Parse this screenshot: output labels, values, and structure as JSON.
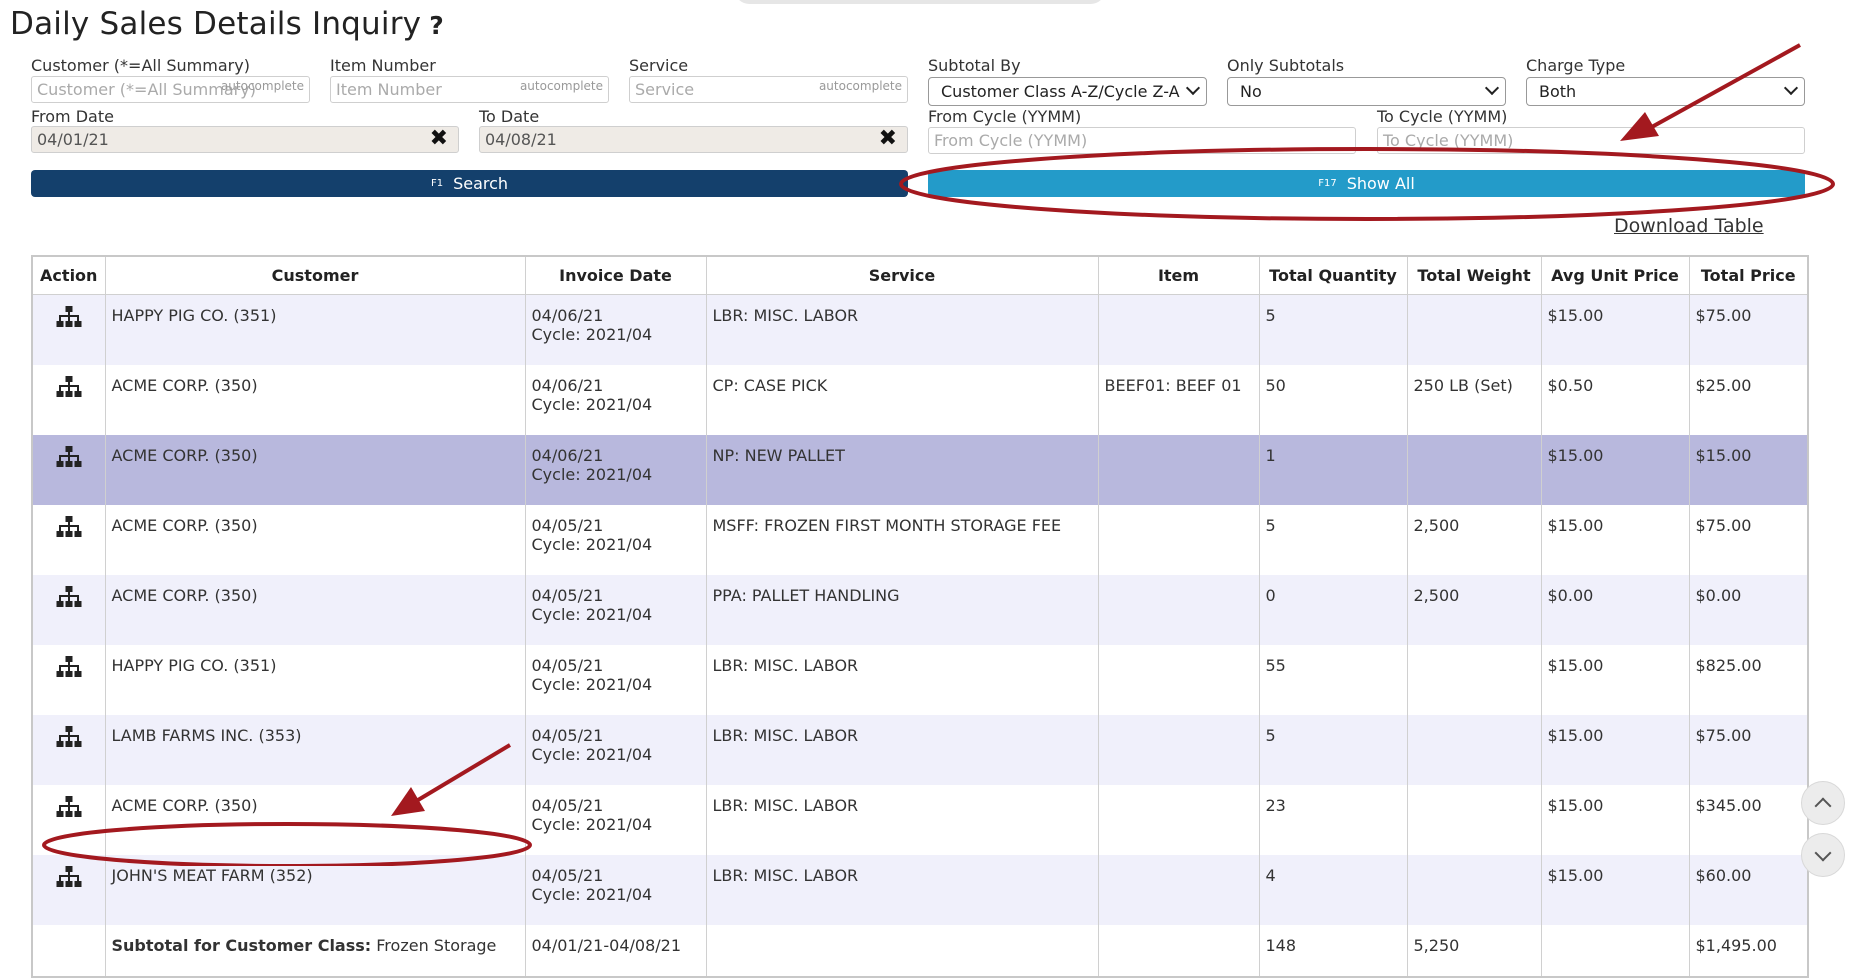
{
  "page": {
    "title": "Daily Sales Details Inquiry",
    "help_glyph": "?"
  },
  "filters": {
    "customer": {
      "label": "Customer (*=All Summary)",
      "placeholder": "Customer (*=All Summary)",
      "hint": "autocomplete"
    },
    "item_number": {
      "label": "Item Number",
      "placeholder": "Item Number",
      "hint": "autocomplete"
    },
    "service": {
      "label": "Service",
      "placeholder": "Service",
      "hint": "autocomplete"
    },
    "subtotal_by": {
      "label": "Subtotal By",
      "value": "Customer Class A-Z/Cycle Z-A"
    },
    "only_subtotals": {
      "label": "Only Subtotals",
      "value": "No"
    },
    "charge_type": {
      "label": "Charge Type",
      "value": "Both"
    },
    "from_date": {
      "label": "From Date",
      "value": "04/01/21",
      "clear_glyph": "✖"
    },
    "to_date": {
      "label": "To Date",
      "value": "04/08/21",
      "clear_glyph": "✖"
    },
    "from_cycle": {
      "label": "From Cycle (YYMM)",
      "placeholder": "From Cycle (YYMM)"
    },
    "to_cycle": {
      "label": "To Cycle (YYMM)",
      "placeholder": "To Cycle (YYMM)"
    }
  },
  "buttons": {
    "search": {
      "key": "F1",
      "label": "Search"
    },
    "show_all": {
      "key": "F17",
      "label": "Show All"
    }
  },
  "download_label": "Download Table",
  "table": {
    "headers": [
      "Action",
      "Customer",
      "Invoice Date",
      "Service",
      "Item",
      "Total Quantity",
      "Total Weight",
      "Avg Unit Price",
      "Total Price"
    ],
    "action_icon": "sitemap-icon",
    "rows": [
      {
        "customer": "HAPPY PIG CO. (351)",
        "date": "04/06/21",
        "cycle": "Cycle: 2021/04",
        "service": "LBR: MISC. LABOR",
        "item": "",
        "qty": "5",
        "weight": "",
        "unit_price": "$15.00",
        "total": "$75.00"
      },
      {
        "customer": "ACME CORP. (350)",
        "date": "04/06/21",
        "cycle": "Cycle: 2021/04",
        "service": "CP: CASE PICK",
        "item": "BEEF01: BEEF 01",
        "qty": "50",
        "weight": "250 LB (Set)",
        "unit_price": "$0.50",
        "total": "$25.00"
      },
      {
        "customer": "ACME CORP. (350)",
        "date": "04/06/21",
        "cycle": "Cycle: 2021/04",
        "service": "NP: NEW PALLET",
        "item": "",
        "qty": "1",
        "weight": "",
        "unit_price": "$15.00",
        "total": "$15.00"
      },
      {
        "customer": "ACME CORP. (350)",
        "date": "04/05/21",
        "cycle": "Cycle: 2021/04",
        "service": "MSFF: FROZEN FIRST MONTH STORAGE FEE",
        "item": "",
        "qty": "5",
        "weight": "2,500",
        "unit_price": "$15.00",
        "total": "$75.00"
      },
      {
        "customer": "ACME CORP. (350)",
        "date": "04/05/21",
        "cycle": "Cycle: 2021/04",
        "service": "PPA: PALLET HANDLING",
        "item": "",
        "qty": "0",
        "weight": "2,500",
        "unit_price": "$0.00",
        "total": "$0.00"
      },
      {
        "customer": "HAPPY PIG CO. (351)",
        "date": "04/05/21",
        "cycle": "Cycle: 2021/04",
        "service": "LBR: MISC. LABOR",
        "item": "",
        "qty": "55",
        "weight": "",
        "unit_price": "$15.00",
        "total": "$825.00"
      },
      {
        "customer": "LAMB FARMS INC. (353)",
        "date": "04/05/21",
        "cycle": "Cycle: 2021/04",
        "service": "LBR: MISC. LABOR",
        "item": "",
        "qty": "5",
        "weight": "",
        "unit_price": "$15.00",
        "total": "$75.00"
      },
      {
        "customer": "ACME CORP. (350)",
        "date": "04/05/21",
        "cycle": "Cycle: 2021/04",
        "service": "LBR: MISC. LABOR",
        "item": "",
        "qty": "23",
        "weight": "",
        "unit_price": "$15.00",
        "total": "$345.00"
      },
      {
        "customer": "JOHN'S MEAT FARM (352)",
        "date": "04/05/21",
        "cycle": "Cycle: 2021/04",
        "service": "LBR: MISC. LABOR",
        "item": "",
        "qty": "4",
        "weight": "",
        "unit_price": "$15.00",
        "total": "$60.00"
      }
    ],
    "subtotal": {
      "label": "Subtotal for Customer Class:",
      "class_name": "Frozen Storage",
      "date_range": "04/01/21-04/08/21",
      "qty": "148",
      "weight": "5,250",
      "total": "$1,495.00"
    }
  },
  "colors": {
    "search_button": "#14406c",
    "show_all_button": "#239bc9",
    "selected_row": "#b8b8dd",
    "alt_row": "#f0f0fb",
    "annotation": "#a3191f"
  }
}
